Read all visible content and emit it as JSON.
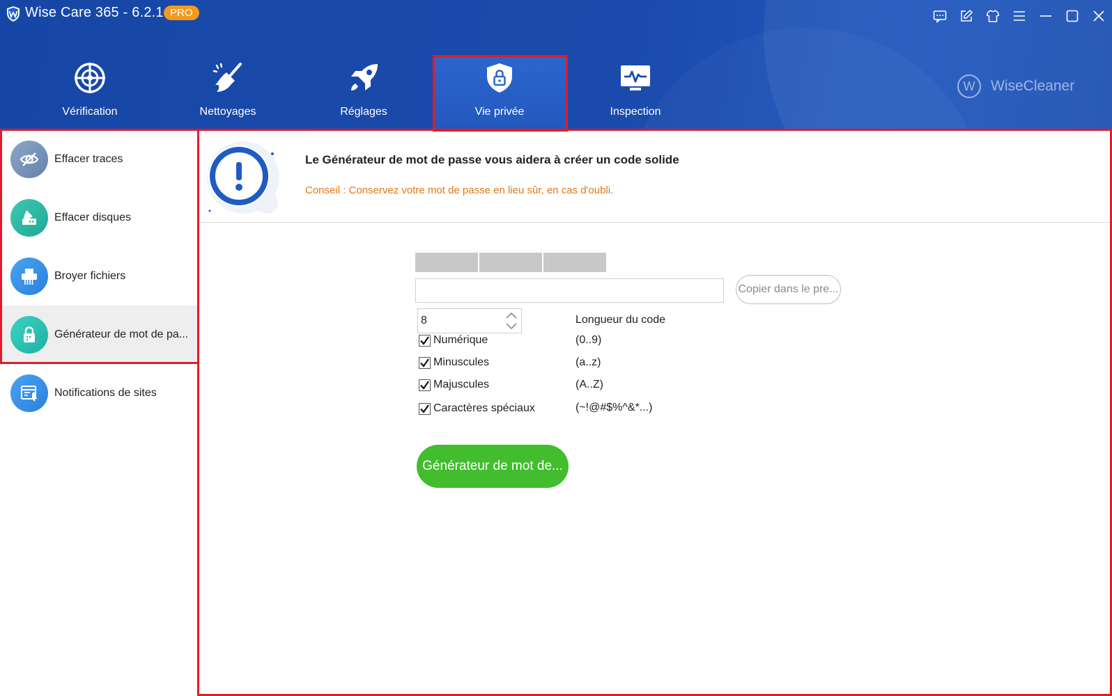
{
  "app": {
    "title": "Wise Care 365 - 6.2.1",
    "badge": "PRO",
    "brand": "WiseCleaner",
    "brand_mark": "W"
  },
  "window_controls": [
    {
      "name": "feedback-icon"
    },
    {
      "name": "edit-icon"
    },
    {
      "name": "skin-icon"
    },
    {
      "name": "menu-icon"
    },
    {
      "name": "minimize-icon"
    },
    {
      "name": "maximize-icon"
    },
    {
      "name": "close-icon"
    }
  ],
  "nav": {
    "tabs": [
      {
        "label": "Vérification",
        "icon": "radar-icon"
      },
      {
        "label": "Nettoyages",
        "icon": "broom-icon"
      },
      {
        "label": "Réglages",
        "icon": "rocket-icon"
      },
      {
        "label": "Vie privée",
        "icon": "shield-lock-icon",
        "active": true
      },
      {
        "label": "Inspection",
        "icon": "monitor-pulse-icon"
      }
    ]
  },
  "sidebar": {
    "items": [
      {
        "label": "Effacer traces",
        "icon": "eye-off-icon"
      },
      {
        "label": "Effacer disques",
        "icon": "disk-eraser-icon"
      },
      {
        "label": "Broyer fichiers",
        "icon": "shredder-icon"
      },
      {
        "label": "Générateur de mot de pa...",
        "icon": "lock-icon",
        "active": true
      },
      {
        "label": "Notifications de sites",
        "icon": "notification-icon"
      }
    ]
  },
  "banner": {
    "title": "Le Générateur de mot de passe vous aidera à créer un code solide",
    "hint": "Conseil : Conservez votre mot de passe en lieu sûr, en cas d'oubli."
  },
  "generator": {
    "strength_segments": 3,
    "password_value": "",
    "copy_label": "Copier dans le pre...",
    "length_value": "8",
    "length_label": "Longueur du code",
    "options": [
      {
        "label": "Numérique",
        "range": "(0..9)",
        "checked": true
      },
      {
        "label": "Minuscules",
        "range": "(a..z)",
        "checked": true
      },
      {
        "label": "Majuscules",
        "range": "(A..Z)",
        "checked": true
      },
      {
        "label": "Caractères spéciaux",
        "range": "(~!@#$%^&*...)",
        "checked": true
      }
    ],
    "generate_label": "Générateur de mot de..."
  },
  "colors": {
    "header_blue": "#1a4aab",
    "active_tab": "#2b66cf",
    "hint_orange": "#e07814",
    "generate_green": "#41bd2e",
    "highlight_red": "#e21b2a"
  }
}
